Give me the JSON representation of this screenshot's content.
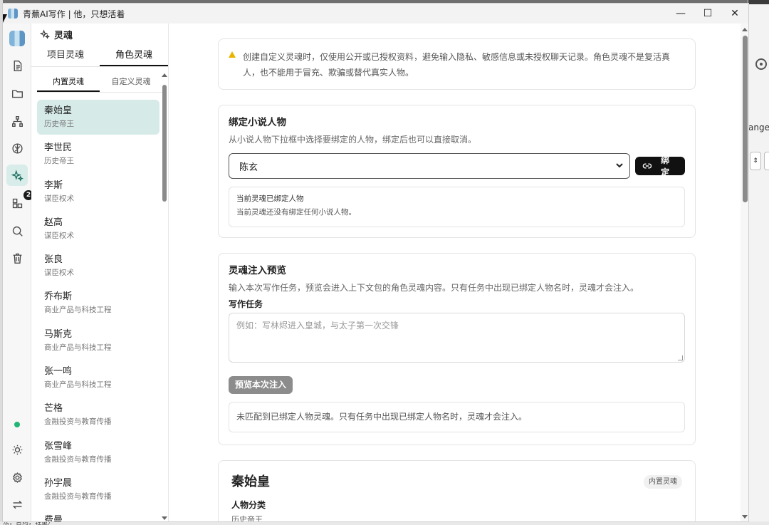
{
  "window": {
    "title": "青蕪AI写作 | 他，只想活着",
    "controls": {
      "minimize": "—",
      "maximize": "☐",
      "close": "✕"
    }
  },
  "background_app": {
    "partial_text": "anges"
  },
  "rail": {
    "items": [
      {
        "name": "document-icon"
      },
      {
        "name": "folder-icon"
      },
      {
        "name": "hierarchy-icon"
      },
      {
        "name": "brain-icon"
      },
      {
        "name": "sparkles-icon",
        "active": true
      },
      {
        "name": "apps-icon",
        "badge": "2"
      },
      {
        "name": "search-icon"
      },
      {
        "name": "trash-icon"
      }
    ],
    "bottom": [
      {
        "name": "sun-icon"
      },
      {
        "name": "gear-icon"
      },
      {
        "name": "swap-icon"
      }
    ],
    "status_color": "#22b573"
  },
  "panel": {
    "title": "灵魂",
    "tabs": [
      "项目灵魂",
      "角色灵魂"
    ],
    "active_tab": 1,
    "subtabs": [
      "内置灵魂",
      "自定义灵魂"
    ],
    "active_subtab": 0,
    "souls": [
      {
        "name": "秦始皇",
        "category": "历史帝王"
      },
      {
        "name": "李世民",
        "category": "历史帝王"
      },
      {
        "name": "李斯",
        "category": "谋臣权术"
      },
      {
        "name": "赵高",
        "category": "谋臣权术"
      },
      {
        "name": "张良",
        "category": "谋臣权术"
      },
      {
        "name": "乔布斯",
        "category": "商业产品与科技工程"
      },
      {
        "name": "马斯克",
        "category": "商业产品与科技工程"
      },
      {
        "name": "张一鸣",
        "category": "商业产品与科技工程"
      },
      {
        "name": "芒格",
        "category": "金融投资与教育传播"
      },
      {
        "name": "张雪峰",
        "category": "金融投资与教育传播"
      },
      {
        "name": "孙宇晨",
        "category": "金融投资与教育传播"
      },
      {
        "name": "费曼",
        "category": ""
      }
    ],
    "active_soul": 0
  },
  "warning": {
    "text": "创建自定义灵魂时，仅使用公开或已授权资料，避免输入隐私、敏感信息或未授权聊天记录。角色灵魂不是复活真人，也不能用于冒充、欺骗或替代真实人物。"
  },
  "bind": {
    "title": "绑定小说人物",
    "desc": "从小说人物下拉框中选择要绑定的人物，绑定后也可以直接取消。",
    "selected": "陈玄",
    "button": "绑定",
    "current_title": "当前灵魂已绑定人物",
    "current_empty": "当前灵魂还没有绑定任何小说人物。"
  },
  "preview": {
    "title": "灵魂注入预览",
    "desc": "输入本次写作任务，预览会进入上下文包的角色灵魂内容。只有任务中出现已绑定人物名时，灵魂才会注入。",
    "field_label": "写作任务",
    "placeholder": "例如：写林烬进入皇城，与太子第一次交锋",
    "button": "预览本次注入",
    "result": "未匹配到已绑定人物灵魂。只有任务中出现已绑定人物名时，灵魂才会注入。"
  },
  "profile": {
    "name": "秦始皇",
    "tag": "内置灵魂",
    "section": "人物分类",
    "value": "历史帝王"
  },
  "bottom_strip": "法，否则，轻量）"
}
